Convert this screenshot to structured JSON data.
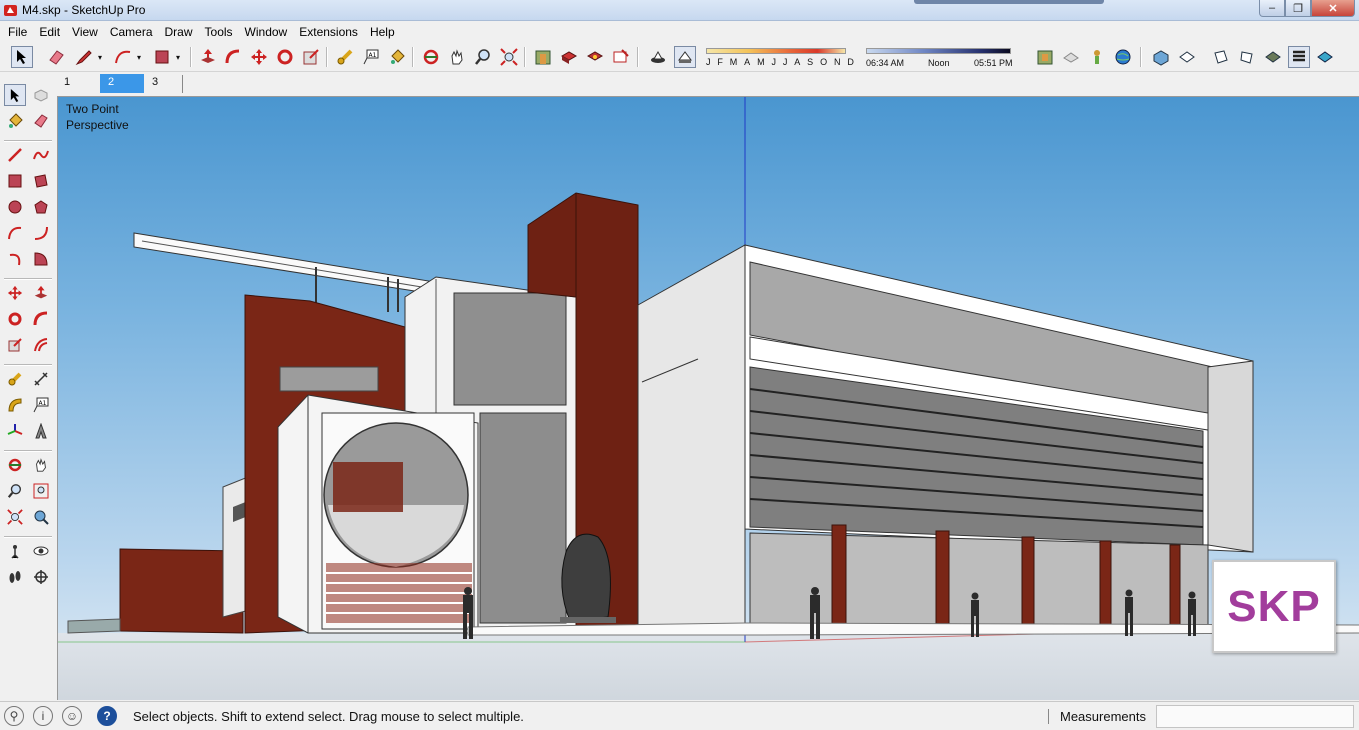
{
  "window": {
    "title": "M4.skp - SketchUp Pro",
    "buttons": {
      "minimize": "‒",
      "restore": "❐",
      "close": "✕"
    }
  },
  "menu": [
    "File",
    "Edit",
    "View",
    "Camera",
    "Draw",
    "Tools",
    "Window",
    "Extensions",
    "Help"
  ],
  "shadows": {
    "months": [
      "J",
      "F",
      "M",
      "A",
      "M",
      "J",
      "J",
      "A",
      "S",
      "O",
      "N",
      "D"
    ],
    "time_start": "06:34 AM",
    "time_mid": "Noon",
    "time_end": "05:51 PM"
  },
  "scenes": {
    "tabs": [
      "1",
      "2",
      "3"
    ],
    "active_index": 1
  },
  "viewport": {
    "camera_label_line1": "Two Point",
    "camera_label_line2": "Perspective",
    "watermark": "SKP",
    "colors": {
      "accent_wall": "#7a2616",
      "sky_top": "#4a96d0",
      "sky_bottom": "#e3ecf3",
      "watermark": "#a23d9c"
    }
  },
  "toolbar_icons": [
    "select-icon",
    "eraser-icon",
    "pencil-icon",
    "arc-icon",
    "rectangle-icon",
    "push-pull-icon",
    "follow-me-icon",
    "move-icon",
    "rotate-icon",
    "scale-icon",
    "tape-measure-icon",
    "text-icon",
    "paint-bucket-icon",
    "orbit-icon",
    "pan-icon",
    "zoom-icon",
    "zoom-extents-icon",
    "warehouse-icon",
    "components-icon",
    "extension-icon",
    "styles-icon",
    "shadows-icon",
    "fog-icon",
    "geo-location-icon",
    "add-location-icon",
    "sandbox-icon",
    "iso-view-icon",
    "top-view-icon",
    "front-view-icon",
    "right-view-icon",
    "back-view-icon",
    "left-view-icon",
    "section-icon"
  ],
  "status": {
    "hint": "Select objects. Shift to extend select. Drag mouse to select multiple.",
    "measurements_label": "Measurements",
    "measurements_value": ""
  }
}
